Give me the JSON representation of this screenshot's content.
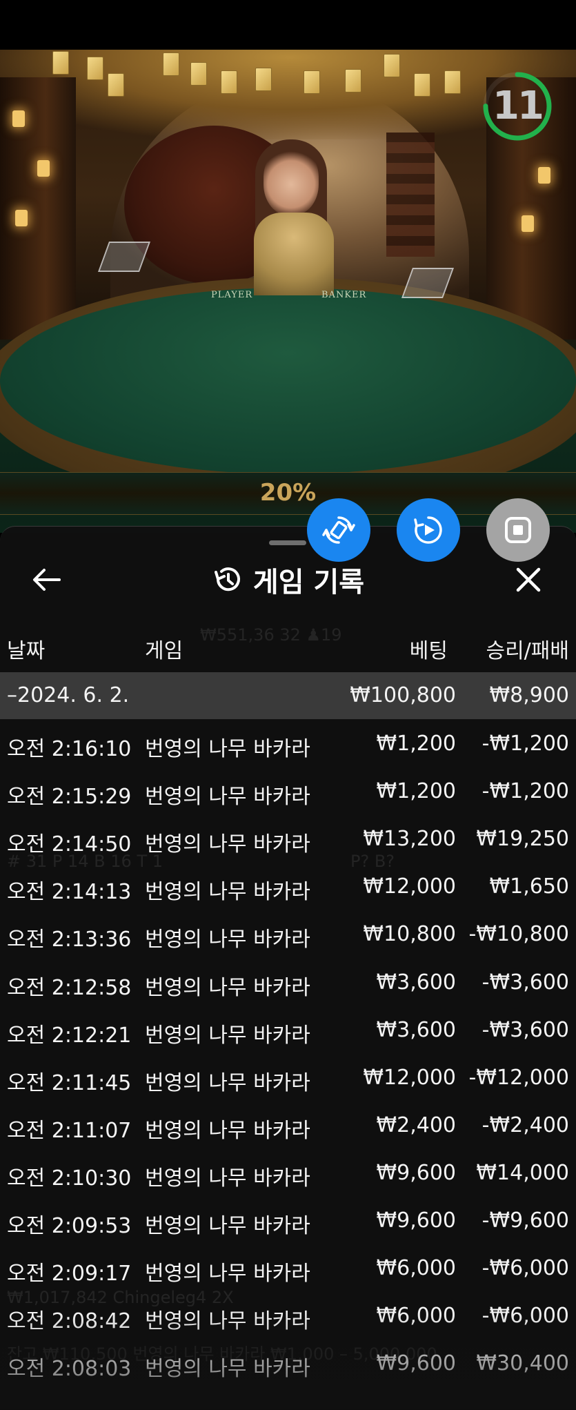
{
  "video": {
    "countdown": "11",
    "countdown_fraction": 0.75,
    "percent": "20%",
    "table_labels": [
      "PLAYER",
      "BANKER"
    ]
  },
  "panel": {
    "title": "게임 기록",
    "columns": {
      "date": "날짜",
      "game": "게임",
      "bet": "베팅",
      "win_loss": "승리/패배"
    },
    "date_group": {
      "date": "–2024. 6. 2.",
      "bet_total": "₩100,800",
      "win_total": "₩8,900"
    },
    "rows": [
      {
        "time": "오전 2:16:10",
        "game": "번영의 나무 바카라",
        "bet": "₩1,200",
        "result": "-₩1,200"
      },
      {
        "time": "오전 2:15:29",
        "game": "번영의 나무 바카라",
        "bet": "₩1,200",
        "result": "-₩1,200"
      },
      {
        "time": "오전 2:14:50",
        "game": "번영의 나무 바카라",
        "bet": "₩13,200",
        "result": "₩19,250"
      },
      {
        "time": "오전 2:14:13",
        "game": "번영의 나무 바카라",
        "bet": "₩12,000",
        "result": "₩1,650"
      },
      {
        "time": "오전 2:13:36",
        "game": "번영의 나무 바카라",
        "bet": "₩10,800",
        "result": "-₩10,800"
      },
      {
        "time": "오전 2:12:58",
        "game": "번영의 나무 바카라",
        "bet": "₩3,600",
        "result": "-₩3,600"
      },
      {
        "time": "오전 2:12:21",
        "game": "번영의 나무 바카라",
        "bet": "₩3,600",
        "result": "-₩3,600"
      },
      {
        "time": "오전 2:11:45",
        "game": "번영의 나무 바카라",
        "bet": "₩12,000",
        "result": "-₩12,000"
      },
      {
        "time": "오전 2:11:07",
        "game": "번영의 나무 바카라",
        "bet": "₩2,400",
        "result": "-₩2,400"
      },
      {
        "time": "오전 2:10:30",
        "game": "번영의 나무 바카라",
        "bet": "₩9,600",
        "result": "₩14,000"
      },
      {
        "time": "오전 2:09:53",
        "game": "번영의 나무 바카라",
        "bet": "₩9,600",
        "result": "-₩9,600"
      },
      {
        "time": "오전 2:09:17",
        "game": "번영의 나무 바카라",
        "bet": "₩6,000",
        "result": "-₩6,000"
      },
      {
        "time": "오전 2:08:42",
        "game": "번영의 나무 바카라",
        "bet": "₩6,000",
        "result": "-₩6,000"
      },
      {
        "time": "오전 2:08:03",
        "game": "번영의 나무 바카라",
        "bet": "₩9,600",
        "result": "₩30,400"
      }
    ],
    "background_ghost": {
      "balance_line": "₩551,36 32 ♟19",
      "stats_line": "# 31   P 14   B 16   T 1",
      "predict_line": "P?        B?",
      "player_line": "₩1,017,842 Chingeleg4  2X",
      "limits_line": "잔고 ₩110,500            번영의 나무 바카라 ₩1,000 – 5,000,000"
    }
  },
  "icons": {
    "back": "arrow-left-icon",
    "close": "close-icon",
    "history": "history-clock-icon",
    "fab1": "rotate-device-icon",
    "fab2": "replay-play-icon",
    "fab3": "stop-square-icon"
  },
  "colors": {
    "fab_blue": "#1a86f0",
    "fab_grey": "#a4a4a4",
    "timer_ring": "#22b14c",
    "percent_gold": "#c9a45a",
    "date_row_bg": "#3a3a3a"
  }
}
